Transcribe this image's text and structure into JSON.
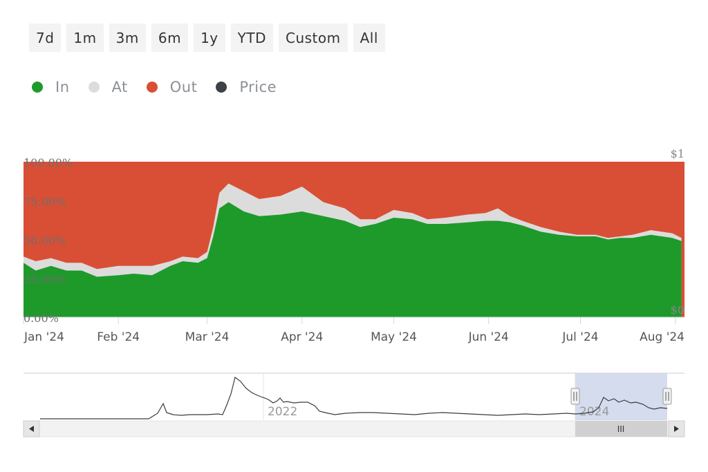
{
  "range_buttons": [
    "7d",
    "1m",
    "3m",
    "6m",
    "1y",
    "YTD",
    "Custom",
    "All"
  ],
  "legend": [
    {
      "label": "In",
      "color": "#1e9a2b"
    },
    {
      "label": "At",
      "color": "#dcdcdc"
    },
    {
      "label": "Out",
      "color": "#d94f35"
    },
    {
      "label": "Price",
      "color": "#3d4148"
    }
  ],
  "chart_data": {
    "type": "area",
    "stacked_percent": true,
    "x_ticks": [
      "Jan '24",
      "Feb '24",
      "Mar '24",
      "Apr '24",
      "May '24",
      "Jun '24",
      "Jul '24",
      "Aug '24"
    ],
    "y_left_ticks": [
      "100.00%",
      "75.00%",
      "50.00%",
      "25.00%",
      "0.00%"
    ],
    "y_right_ticks": [
      "$1",
      "$0"
    ],
    "ylim": [
      0,
      100
    ],
    "series": [
      {
        "name": "In",
        "points": [
          [
            "2024-01-01",
            35
          ],
          [
            "2024-01-05",
            30
          ],
          [
            "2024-01-10",
            33
          ],
          [
            "2024-01-15",
            30
          ],
          [
            "2024-01-20",
            30
          ],
          [
            "2024-01-25",
            26
          ],
          [
            "2024-02-01",
            27
          ],
          [
            "2024-02-06",
            28
          ],
          [
            "2024-02-12",
            27
          ],
          [
            "2024-02-18",
            33
          ],
          [
            "2024-02-22",
            36
          ],
          [
            "2024-02-27",
            35
          ],
          [
            "2024-03-01",
            38
          ],
          [
            "2024-03-03",
            52
          ],
          [
            "2024-03-05",
            70
          ],
          [
            "2024-03-08",
            74
          ],
          [
            "2024-03-13",
            68
          ],
          [
            "2024-03-18",
            65
          ],
          [
            "2024-03-25",
            66
          ],
          [
            "2024-04-01",
            68
          ],
          [
            "2024-04-08",
            65
          ],
          [
            "2024-04-15",
            62
          ],
          [
            "2024-04-20",
            58
          ],
          [
            "2024-04-25",
            60
          ],
          [
            "2024-05-01",
            64
          ],
          [
            "2024-05-07",
            63
          ],
          [
            "2024-05-12",
            60
          ],
          [
            "2024-05-18",
            60
          ],
          [
            "2024-05-25",
            61
          ],
          [
            "2024-05-31",
            62
          ],
          [
            "2024-06-04",
            62
          ],
          [
            "2024-06-08",
            61
          ],
          [
            "2024-06-12",
            59
          ],
          [
            "2024-06-18",
            55
          ],
          [
            "2024-06-24",
            53
          ],
          [
            "2024-06-30",
            52
          ],
          [
            "2024-07-06",
            52
          ],
          [
            "2024-07-10",
            50
          ],
          [
            "2024-07-14",
            51
          ],
          [
            "2024-07-18",
            51
          ],
          [
            "2024-07-24",
            53
          ],
          [
            "2024-07-31",
            51
          ],
          [
            "2024-08-03",
            49
          ]
        ]
      },
      {
        "name": "At",
        "points": [
          [
            "2024-01-01",
            39
          ],
          [
            "2024-01-05",
            36
          ],
          [
            "2024-01-10",
            38
          ],
          [
            "2024-01-15",
            35
          ],
          [
            "2024-01-20",
            35
          ],
          [
            "2024-01-25",
            31
          ],
          [
            "2024-02-01",
            33
          ],
          [
            "2024-02-06",
            33
          ],
          [
            "2024-02-12",
            33
          ],
          [
            "2024-02-18",
            36
          ],
          [
            "2024-02-22",
            39
          ],
          [
            "2024-02-27",
            38
          ],
          [
            "2024-03-01",
            42
          ],
          [
            "2024-03-03",
            58
          ],
          [
            "2024-03-05",
            80
          ],
          [
            "2024-03-08",
            86
          ],
          [
            "2024-03-13",
            81
          ],
          [
            "2024-03-18",
            76
          ],
          [
            "2024-03-25",
            78
          ],
          [
            "2024-04-01",
            84
          ],
          [
            "2024-04-08",
            74
          ],
          [
            "2024-04-15",
            70
          ],
          [
            "2024-04-20",
            63
          ],
          [
            "2024-04-25",
            63
          ],
          [
            "2024-05-01",
            69
          ],
          [
            "2024-05-07",
            67
          ],
          [
            "2024-05-12",
            63
          ],
          [
            "2024-05-18",
            64
          ],
          [
            "2024-05-25",
            66
          ],
          [
            "2024-05-31",
            67
          ],
          [
            "2024-06-04",
            70
          ],
          [
            "2024-06-08",
            65
          ],
          [
            "2024-06-12",
            62
          ],
          [
            "2024-06-18",
            58
          ],
          [
            "2024-06-24",
            55
          ],
          [
            "2024-06-30",
            53
          ],
          [
            "2024-07-06",
            53
          ],
          [
            "2024-07-10",
            51
          ],
          [
            "2024-07-14",
            52
          ],
          [
            "2024-07-18",
            53
          ],
          [
            "2024-07-24",
            56
          ],
          [
            "2024-07-31",
            54
          ],
          [
            "2024-08-03",
            51
          ]
        ]
      }
    ]
  },
  "navigator": {
    "labels": [
      "2022",
      "2024"
    ],
    "scroll_handle_glyph": "III"
  }
}
